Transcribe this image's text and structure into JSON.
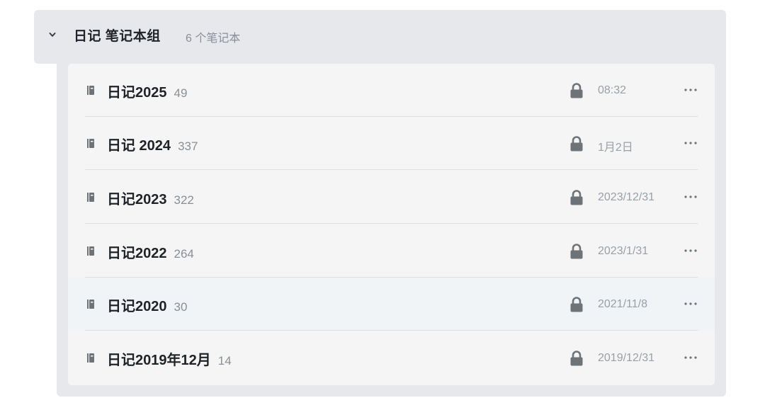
{
  "group": {
    "title": "日记 笔记本组",
    "count_label": "6 个笔记本"
  },
  "notebooks": [
    {
      "name": "日记2025",
      "count": "49",
      "date": "08:32",
      "locked": true
    },
    {
      "name": "日记 2024",
      "count": "337",
      "date": "1月2日",
      "locked": true
    },
    {
      "name": "日记2023",
      "count": "322",
      "date": "2023/12/31",
      "locked": true
    },
    {
      "name": "日记2022",
      "count": "264",
      "date": "2023/1/31",
      "locked": true
    },
    {
      "name": "日记2020",
      "count": "30",
      "date": "2021/11/8",
      "locked": true
    },
    {
      "name": "日记2019年12月",
      "count": "14",
      "date": "2019/12/31",
      "locked": true
    }
  ],
  "icons": {
    "group_toggle": "chevron-down-icon",
    "notebook": "notebook-icon",
    "lock": "lock-icon",
    "more": "more-icon"
  },
  "colors": {
    "group_background": "#e6e8eb",
    "card_background": "#f5f5f5",
    "highlight_row": "#f1f4f7",
    "text_primary": "#1f2328",
    "text_secondary": "#8a8f96",
    "icon_gray": "#6e7378"
  }
}
